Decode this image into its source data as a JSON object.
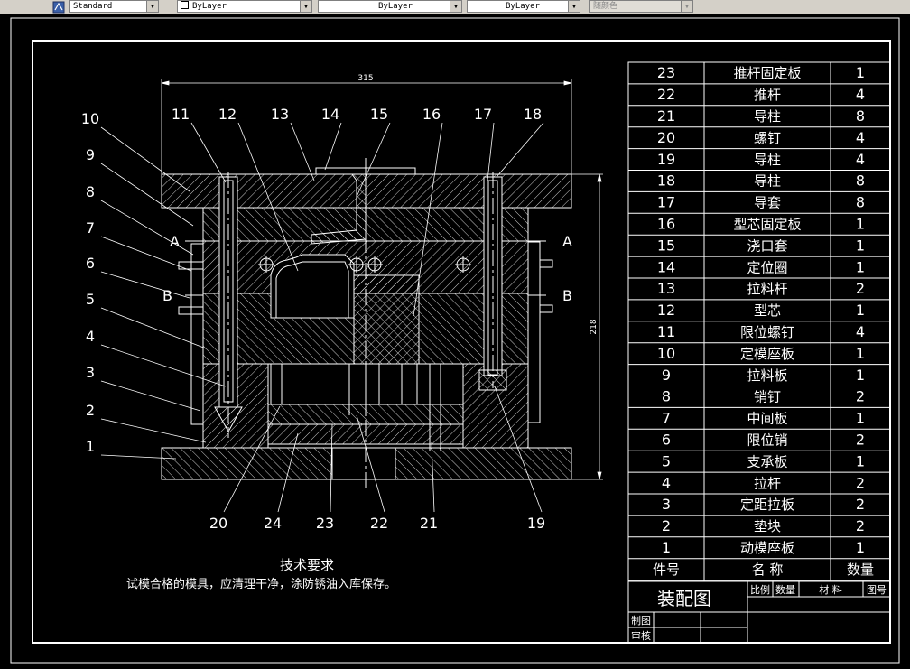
{
  "toolbar": {
    "textstyle": "Standard",
    "layer": "ByLayer",
    "linetype": "ByLayer",
    "lineweight": "ByLayer",
    "plotstyle": "随颜色"
  },
  "drawing": {
    "dim_width": "315",
    "dim_height": "218",
    "section_a": "A",
    "section_b": "B",
    "callouts": [
      "1",
      "2",
      "3",
      "4",
      "5",
      "6",
      "7",
      "8",
      "9",
      "10",
      "11",
      "12",
      "13",
      "14",
      "15",
      "16",
      "17",
      "18",
      "19",
      "20",
      "21",
      "22",
      "23",
      "24"
    ],
    "tech_title": "技术要求",
    "tech_note": "试模合格的模具，应清理干净，涂防锈油入库保存。"
  },
  "bom": {
    "rows": [
      {
        "no": "23",
        "name": "推杆固定板",
        "qty": "1"
      },
      {
        "no": "22",
        "name": "推杆",
        "qty": "4"
      },
      {
        "no": "21",
        "name": "导柱",
        "qty": "8"
      },
      {
        "no": "20",
        "name": "螺钉",
        "qty": "4"
      },
      {
        "no": "19",
        "name": "导柱",
        "qty": "4"
      },
      {
        "no": "18",
        "name": "导柱",
        "qty": "8"
      },
      {
        "no": "17",
        "name": "导套",
        "qty": "8"
      },
      {
        "no": "16",
        "name": "型芯固定板",
        "qty": "1"
      },
      {
        "no": "15",
        "name": "浇口套",
        "qty": "1"
      },
      {
        "no": "14",
        "name": "定位圈",
        "qty": "1"
      },
      {
        "no": "13",
        "name": "拉料杆",
        "qty": "2"
      },
      {
        "no": "12",
        "name": "型芯",
        "qty": "1"
      },
      {
        "no": "11",
        "name": "限位螺钉",
        "qty": "4"
      },
      {
        "no": "10",
        "name": "定模座板",
        "qty": "1"
      },
      {
        "no": "9",
        "name": "拉料板",
        "qty": "1"
      },
      {
        "no": "8",
        "name": "销钉",
        "qty": "2"
      },
      {
        "no": "7",
        "name": "中间板",
        "qty": "1"
      },
      {
        "no": "6",
        "name": "限位销",
        "qty": "2"
      },
      {
        "no": "5",
        "name": "支承板",
        "qty": "1"
      },
      {
        "no": "4",
        "name": "拉杆",
        "qty": "2"
      },
      {
        "no": "3",
        "name": "定距拉板",
        "qty": "2"
      },
      {
        "no": "2",
        "name": "垫块",
        "qty": "2"
      },
      {
        "no": "1",
        "name": "动模座板",
        "qty": "1"
      }
    ],
    "header": {
      "no": "件号",
      "name": "名  称",
      "qty": "数量"
    }
  },
  "titleblock": {
    "title": "装配图",
    "scale": "比例",
    "count": "数量",
    "material": "材  料",
    "drawing_no": "图号",
    "drawn": "制图",
    "checked": "审核"
  }
}
